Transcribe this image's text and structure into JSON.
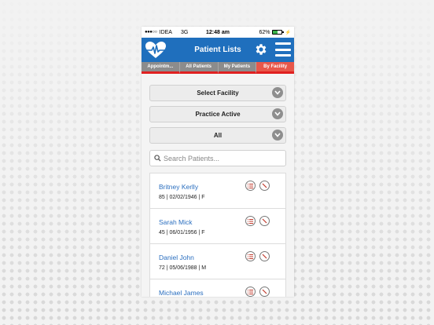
{
  "status_bar": {
    "carrier": "IDEA",
    "network": "3G",
    "time": "12:48 am",
    "battery": "62%",
    "battery_level": 0.62
  },
  "header": {
    "title": "Patient Lists"
  },
  "tabs": [
    {
      "label": "Appointm...",
      "active": false
    },
    {
      "label": "All Patients",
      "active": false
    },
    {
      "label": "My Patients",
      "active": false
    },
    {
      "label": "By Facility",
      "active": true
    }
  ],
  "filters": {
    "facility": "Select Facility",
    "practice": "Practice Active",
    "status": "All"
  },
  "search": {
    "placeholder": "Search Patients..."
  },
  "patients": [
    {
      "name": "Britney Kerlly",
      "info": "85 | 02/02/1946 | F"
    },
    {
      "name": "Sarah Mick",
      "info": "45 | 06/01/1956 | F"
    },
    {
      "name": "Daniel John",
      "info": "72 | 05/06/1988 | M"
    },
    {
      "name": "Michael James",
      "info": ""
    }
  ],
  "colors": {
    "header": "#1f6fbd",
    "active_tab": "#e8574a",
    "tab": "#8c8c8c",
    "link": "#2a6ebf",
    "accent_red": "#e02020"
  }
}
